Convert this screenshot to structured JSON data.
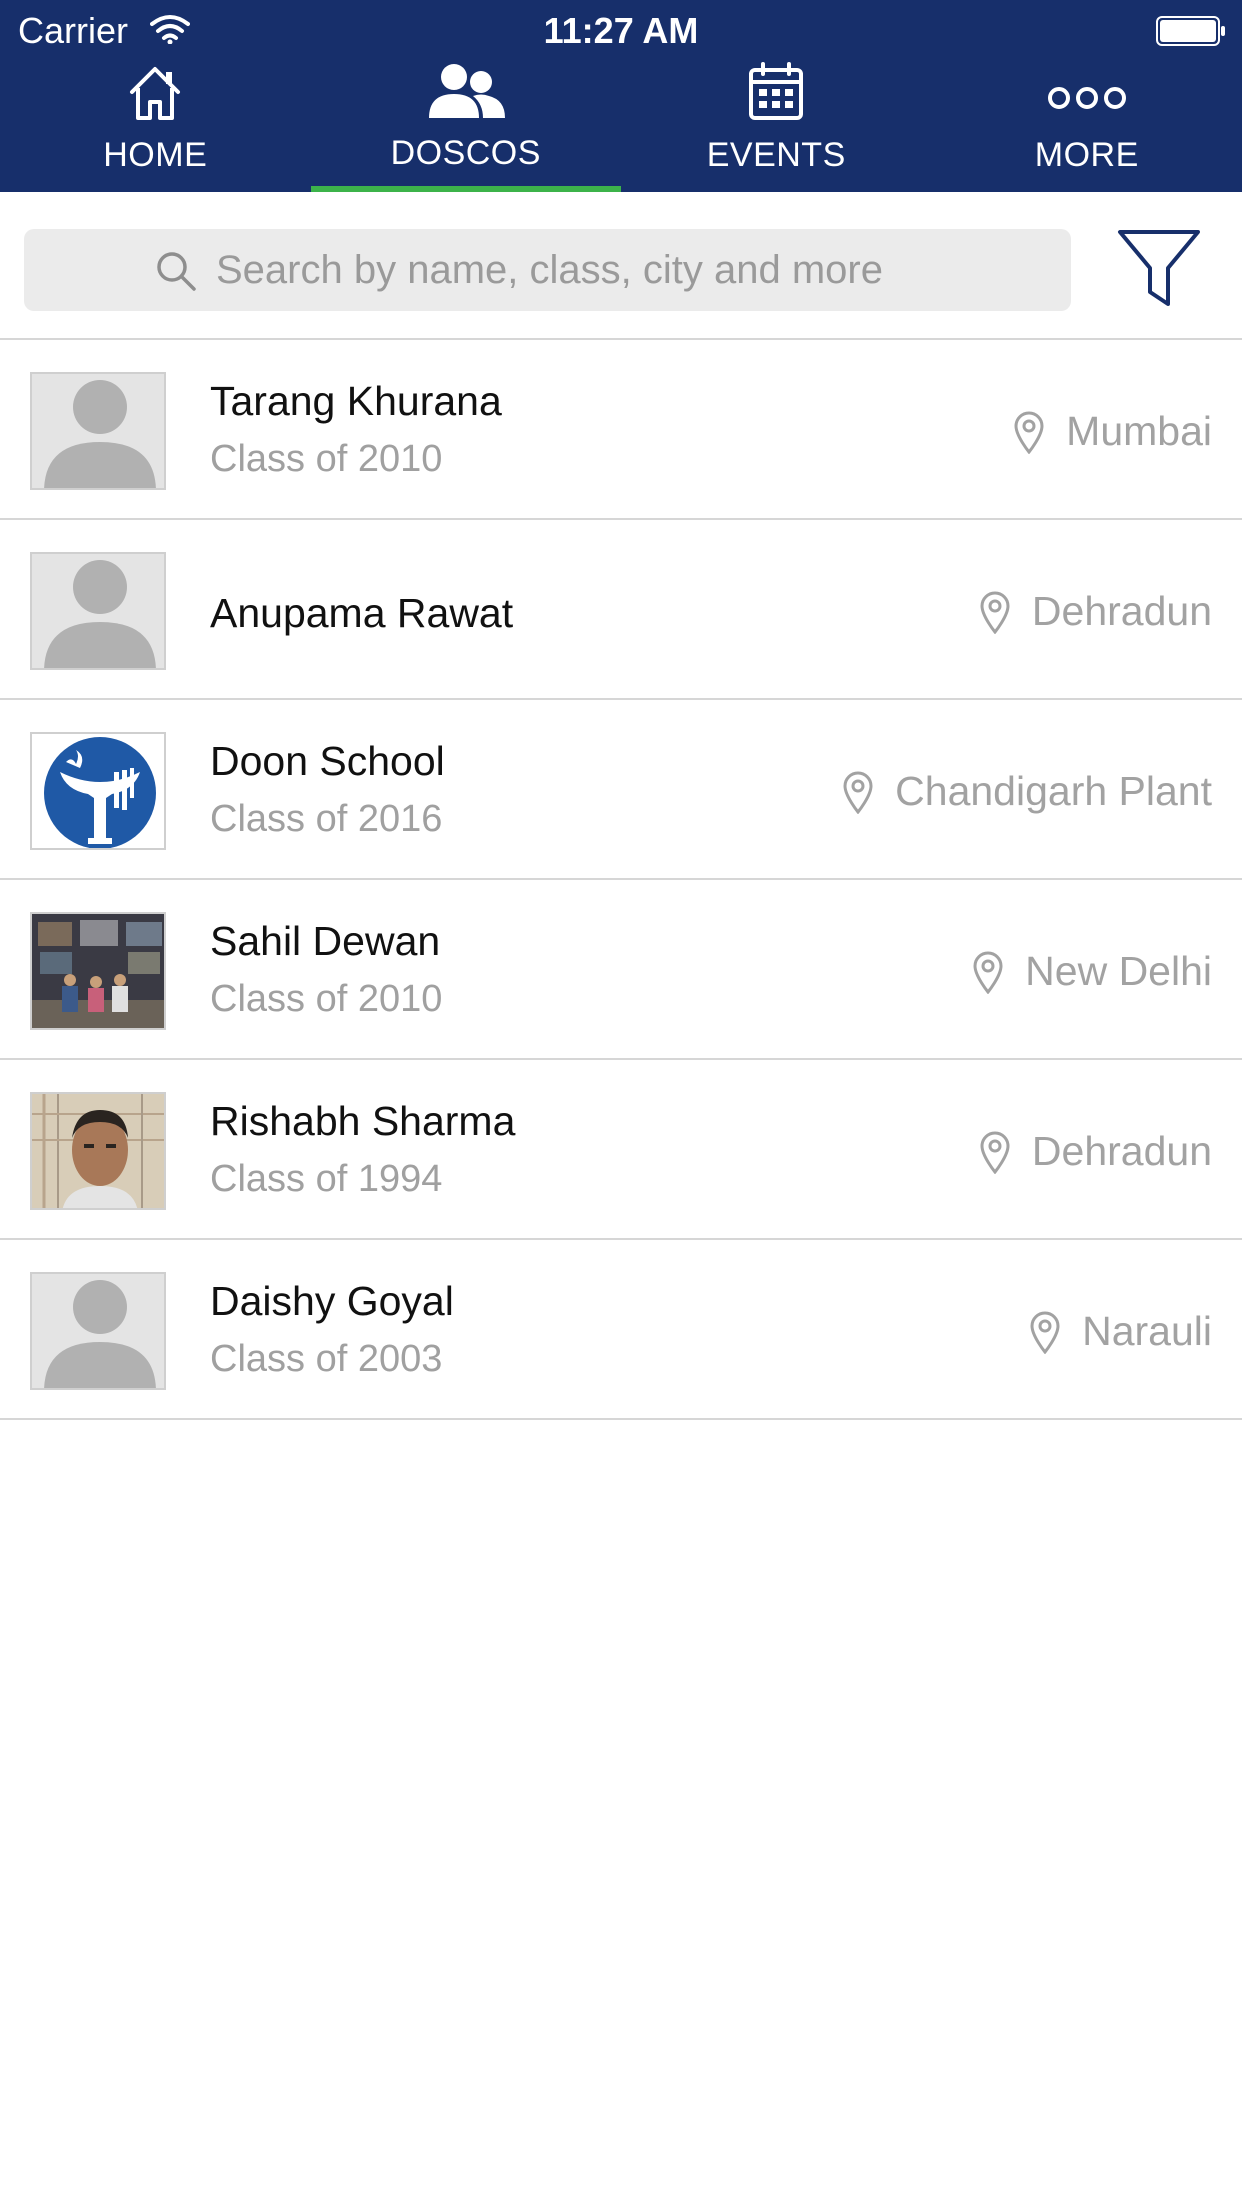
{
  "status_bar": {
    "carrier": "Carrier",
    "time": "11:27 AM"
  },
  "nav": {
    "tabs": [
      {
        "label": "HOME",
        "icon": "home-icon",
        "active": false
      },
      {
        "label": "DOSCOS",
        "icon": "people-icon",
        "active": true
      },
      {
        "label": "EVENTS",
        "icon": "calendar-icon",
        "active": false
      },
      {
        "label": "MORE",
        "icon": "more-dots-icon",
        "active": false
      }
    ],
    "active_indicator_color": "#3cb34a",
    "background_color": "#172f6b"
  },
  "search": {
    "placeholder": "Search by name, class, city and more",
    "value": ""
  },
  "filter": {
    "icon": "filter-icon"
  },
  "members": [
    {
      "name": "Tarang Khurana",
      "class": "Class of 2010",
      "location": "Mumbai",
      "avatar": "placeholder-avatar"
    },
    {
      "name": "Anupama Rawat",
      "class": "",
      "location": "Dehradun",
      "avatar": "placeholder-avatar"
    },
    {
      "name": "Doon School",
      "class": "Class of 2016",
      "location": "Chandigarh Plant",
      "avatar": "school-logo"
    },
    {
      "name": "Sahil Dewan",
      "class": "Class of 2010",
      "location": "New Delhi",
      "avatar": "group-photo"
    },
    {
      "name": "Rishabh Sharma",
      "class": "Class of 1994",
      "location": "Dehradun",
      "avatar": "portrait-photo"
    },
    {
      "name": "Daishy Goyal",
      "class": "Class of 2003",
      "location": "Narauli",
      "avatar": "placeholder-avatar"
    }
  ]
}
